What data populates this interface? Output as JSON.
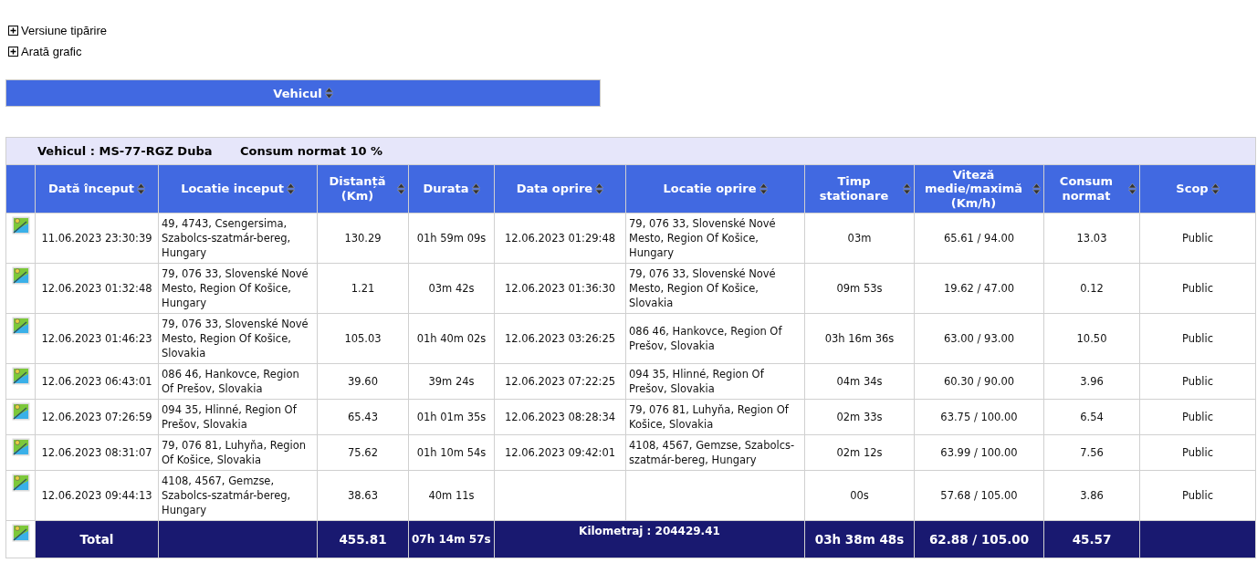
{
  "toggles": [
    {
      "label": "Versiune tipărire",
      "expanded": false
    },
    {
      "label": "Arată grafic",
      "expanded": false
    }
  ],
  "group_header": {
    "label": "Vehicul"
  },
  "vehicle_info": {
    "vehicle": "Vehicul : MS-77-RGZ Duba",
    "consumption": "Consum normat 10 %"
  },
  "table": {
    "columns": [
      "Dată început",
      "Locatie inceput",
      "Distanță (Km)",
      "Durata",
      "Data oprire",
      "Locatie oprire",
      "Timp stationare",
      "Viteză medie/maximă (Km/h)",
      "Consum normat",
      "Scop"
    ],
    "rows": [
      {
        "cells": [
          "11.06.2023 23:30:39",
          "49,  4743, Csengersima, Szabolcs-szatmár-bereg, Hungary",
          "130.29",
          "01h 59m 09s",
          "12.06.2023 01:29:48",
          "79,  076 33, Slovenské Nové Mesto, Region Of Košice, Hungary",
          "03m",
          "65.61 / 94.00",
          "13.03",
          "Public"
        ]
      },
      {
        "cells": [
          "12.06.2023 01:32:48",
          "79,  076 33, Slovenské Nové Mesto, Region Of Košice, Hungary",
          "1.21",
          "03m 42s",
          "12.06.2023 01:36:30",
          "79,  076 33, Slovenské Nové Mesto, Region Of Košice, Slovakia",
          "09m 53s",
          "19.62 / 47.00",
          "0.12",
          "Public"
        ]
      },
      {
        "cells": [
          "12.06.2023 01:46:23",
          "79,  076 33, Slovenské Nové Mesto, Region Of Košice, Slovakia",
          "105.03",
          "01h 40m 02s",
          "12.06.2023 03:26:25",
          "086 46, Hankovce, Region Of Prešov, Slovakia",
          "03h 16m 36s",
          "63.00 / 93.00",
          "10.50",
          "Public"
        ]
      },
      {
        "cells": [
          "12.06.2023 06:43:01",
          "086 46, Hankovce, Region Of Prešov, Slovakia",
          "39.60",
          "39m 24s",
          "12.06.2023 07:22:25",
          "094 35, Hlinné, Region Of Prešov, Slovakia",
          "04m 34s",
          "60.30 / 90.00",
          "3.96",
          "Public"
        ]
      },
      {
        "cells": [
          "12.06.2023 07:26:59",
          "094 35, Hlinné, Region Of Prešov, Slovakia",
          "65.43",
          "01h 01m 35s",
          "12.06.2023 08:28:34",
          "79,  076 81, Luhyňa, Region Of Košice, Slovakia",
          "02m 33s",
          "63.75 / 100.00",
          "6.54",
          "Public"
        ]
      },
      {
        "cells": [
          "12.06.2023 08:31:07",
          "79,  076 81, Luhyňa, Region Of Košice, Slovakia",
          "75.62",
          "01h 10m 54s",
          "12.06.2023 09:42:01",
          "4108,  4567, Gemzse, Szabolcs-szatmár-bereg, Hungary",
          "02m 12s",
          "63.99 / 100.00",
          "7.56",
          "Public"
        ]
      },
      {
        "cells": [
          "12.06.2023 09:44:13",
          "4108,  4567, Gemzse, Szabolcs-szatmár-bereg, Hungary",
          "38.63",
          "40m 11s",
          "",
          "",
          "00s",
          "57.68 / 105.00",
          "3.86",
          "Public"
        ]
      }
    ],
    "total": {
      "label": "Total",
      "distance": "455.81",
      "duration": "07h 14m 57s",
      "odometer": "Kilometraj : 204429.41",
      "idle": "03h 38m 48s",
      "speed": "62.88 / 105.00",
      "consumption": "45.57"
    }
  }
}
